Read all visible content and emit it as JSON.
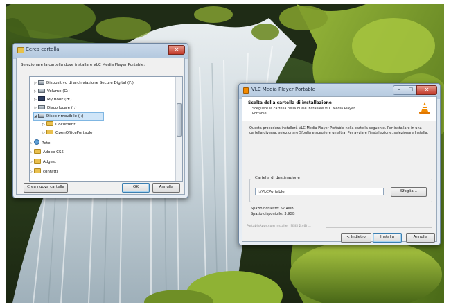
{
  "folder_dialog": {
    "title": "Cerca cartella",
    "description": "Selezionare la cartella dove installare VLC Media Player Portable:",
    "tree": [
      {
        "label": "Dispositivo di archiviazione Secure Digital (F:)",
        "icon": "usb-drive-icon"
      },
      {
        "label": "Volume (G:)",
        "icon": "drive-icon"
      },
      {
        "label": "My Book (H:)",
        "icon": "external-drive-icon"
      },
      {
        "label": "Disco locale (I:)",
        "icon": "drive-icon"
      },
      {
        "label": "Disco rimovibile (J:)",
        "icon": "removable-drive-icon",
        "selected": true,
        "expanded": true
      },
      {
        "label": "Documenti",
        "icon": "folder-icon"
      },
      {
        "label": "OpenOfficePortable",
        "icon": "folder-icon"
      },
      {
        "label": "Rete",
        "icon": "network-icon"
      },
      {
        "label": "Adobe CS5",
        "icon": "folder-icon"
      },
      {
        "label": "Adgest",
        "icon": "folder-icon"
      },
      {
        "label": "contatti",
        "icon": "folder-icon"
      }
    ],
    "new_folder_label": "Crea nuova cartella",
    "ok_label": "OK",
    "cancel_label": "Annulla",
    "close_label": "✕"
  },
  "installer": {
    "title": "VLC Media Player Portable",
    "header_title": "Scelta della cartella di installazione",
    "header_subtitle": "Scegliere la cartella nella quale installare VLC Media Player Portable.",
    "body": "Questa procedura installerà VLC Media Player Portable nella cartella seguente. Per installare in una cartella diversa, selezionare Sfoglia e scegliere un'altra. Per avviare l'installazione, selezionare Installa.",
    "group_label": "Cartella di destinazione",
    "destination_value": "J:\\VLCPortable",
    "browse_label": "Sfoglia...",
    "space_required": "Spazio richiesto: 57.4MB",
    "space_available": "Spazio disponibile: 3.9GB",
    "branding": "PortableApps.com Installer (NSIS 2.46) ...",
    "back_label": "< Indietro",
    "install_label": "Installa",
    "cancel_label": "Annulla",
    "min_label": "–",
    "max_label": "□",
    "close_label": "✕",
    "accent": "#f28a00"
  }
}
